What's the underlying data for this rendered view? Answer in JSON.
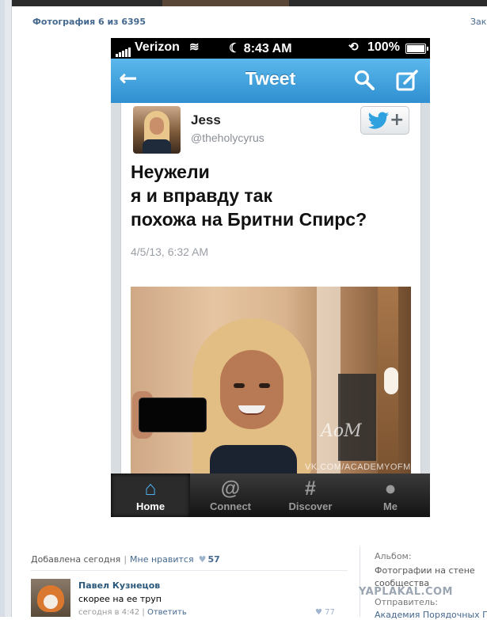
{
  "viewer": {
    "title": "Фотография 6 из 6395",
    "close_label": "Зак"
  },
  "status_bar": {
    "carrier": "Verizon",
    "time": "8:43 AM",
    "battery": "100%"
  },
  "navbar": {
    "back_icon": "arrow-left-icon",
    "title": "Tweet",
    "search_icon": "search-icon",
    "compose_icon": "compose-icon"
  },
  "tweet": {
    "name": "Jess",
    "handle": "@theholycyrus",
    "follow_icon": "twitter-bird-icon",
    "follow_plus": "+",
    "text_lines": [
      "Неужели",
      "я и вправду так",
      "похожа на Бритни Спирс?"
    ],
    "timestamp": "4/5/13, 6:32 AM",
    "watermark": "VK.COM/ACADEMYOFMAN",
    "watermark_art": "AoM"
  },
  "tabs": [
    {
      "label": "Home",
      "icon": "house-icon",
      "glyph": "⌂",
      "active": true
    },
    {
      "label": "Connect",
      "icon": "at-icon",
      "glyph": "@",
      "active": false
    },
    {
      "label": "Discover",
      "icon": "hash-icon",
      "glyph": "#",
      "active": false
    },
    {
      "label": "Me",
      "icon": "person-icon",
      "glyph": "●",
      "active": false
    }
  ],
  "meta": {
    "added": "Добавлена сегодня",
    "separator": "|",
    "like_label": "Мне нравится",
    "heart": "♥",
    "like_count": "57"
  },
  "album": {
    "label": "Альбом:",
    "name": "Фотографии на стене сообщества",
    "sender_label": "Отправитель:",
    "sender": "Академия Порядочных Парн"
  },
  "brand_stamp": "YAPLAKAL.COM",
  "comment": {
    "author": "Павел Кузнецов",
    "text": "скорее на ее труп",
    "time": "сегодня в 4:42",
    "separator": "|",
    "reply": "Ответить",
    "heart": "♥",
    "likes": "77"
  },
  "colors": {
    "link": "#45688e",
    "twitter_blue": "#2f8fd0",
    "tab_active": "#4ab0f0"
  }
}
